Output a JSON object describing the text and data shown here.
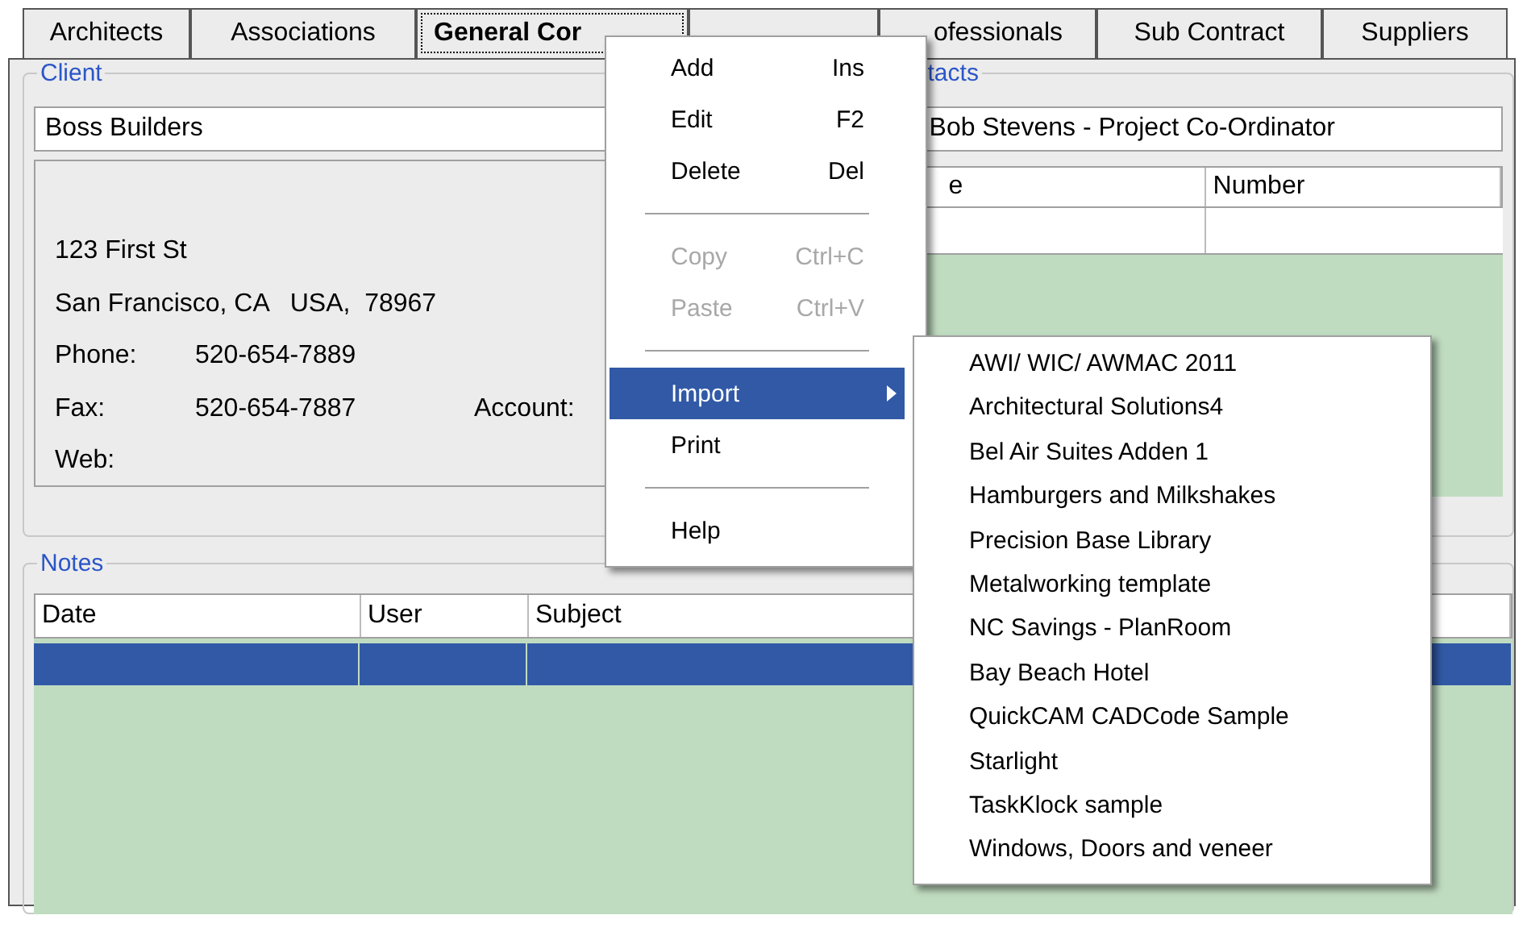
{
  "tabs": [
    {
      "label": "Architects",
      "selected": false
    },
    {
      "label": "Associations",
      "selected": false
    },
    {
      "label": "General Cor",
      "selected": true
    },
    {
      "selected": false
    },
    {
      "label": "ofessionals",
      "selected": false
    },
    {
      "label": "Sub Contract",
      "selected": false
    },
    {
      "label": "Suppliers",
      "selected": false
    }
  ],
  "client": {
    "title": "Client",
    "name": "Boss Builders",
    "address": [
      "123 First St",
      "San Francisco, CA   USA,  78967"
    ],
    "fields": [
      {
        "label": "Phone:",
        "value": "520-654-7889"
      },
      {
        "label": "Fax:",
        "value": "520-654-7887"
      },
      {
        "label": "Web:"
      }
    ],
    "account_label": "Account:"
  },
  "contacts": {
    "title": "tacts",
    "contact": "Bob Stevens - Project Co-Ordinator",
    "columns": [
      "e",
      "Number"
    ]
  },
  "notes": {
    "title": "Notes",
    "columns": [
      "Date",
      "User",
      "Subject"
    ],
    "rows": [
      {
        "selected": true
      }
    ]
  },
  "context_menu": {
    "items": [
      {
        "kind": "item",
        "label": "Add",
        "shortcut": "Ins",
        "disabled": false
      },
      {
        "kind": "item",
        "label": "Edit",
        "shortcut": "F2",
        "disabled": false
      },
      {
        "kind": "item",
        "label": "Delete",
        "shortcut": "Del",
        "disabled": false
      },
      {
        "kind": "separator"
      },
      {
        "kind": "item",
        "label": "Copy",
        "shortcut": "Ctrl+C",
        "disabled": true
      },
      {
        "kind": "item",
        "label": "Paste",
        "shortcut": "Ctrl+V",
        "disabled": true
      },
      {
        "kind": "separator"
      },
      {
        "kind": "submenu",
        "label": "Import",
        "highlighted": true
      },
      {
        "kind": "item",
        "label": "Print",
        "disabled": false
      },
      {
        "kind": "separator"
      },
      {
        "kind": "item",
        "label": "Help",
        "disabled": false
      }
    ]
  },
  "import_submenu": {
    "items": [
      "AWI/ WIC/ AWMAC 2011",
      "Architectural Solutions4",
      "Bel Air Suites Adden 1",
      "Hamburgers and Milkshakes",
      "Precision Base Library",
      "Metalworking template",
      "NC Savings - PlanRoom",
      "Bay Beach Hotel",
      "QuickCAM CADCode Sample",
      "Starlight",
      "TaskKlock sample",
      "Windows, Doors and veneer"
    ]
  }
}
